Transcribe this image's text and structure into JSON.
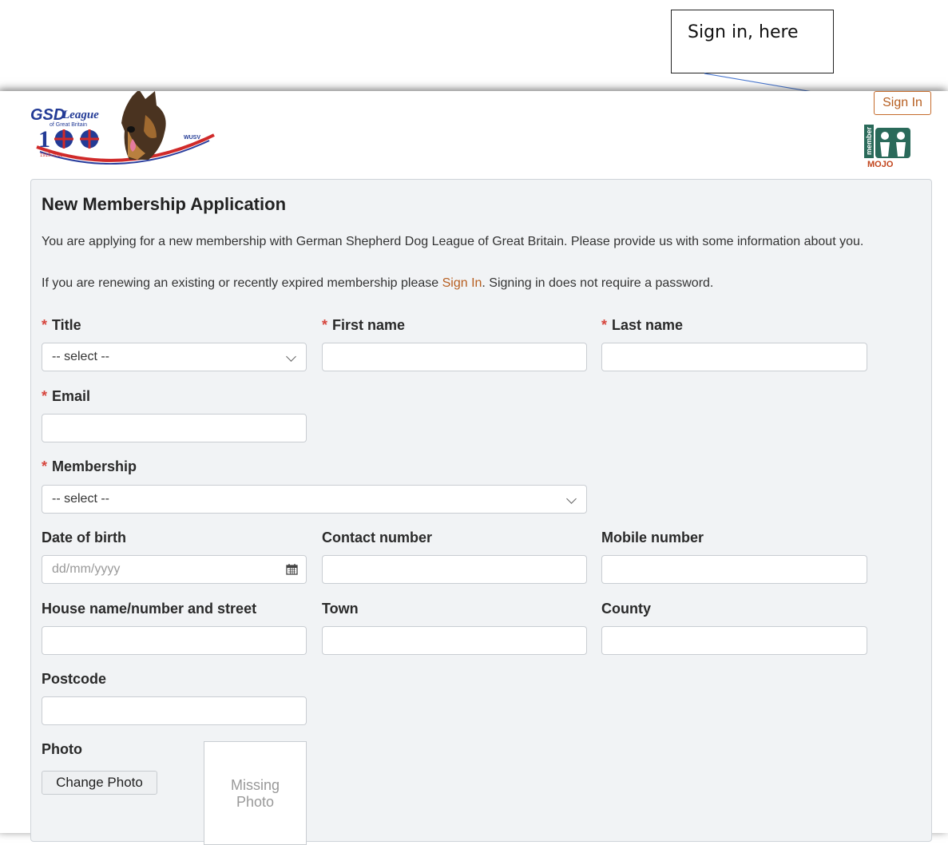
{
  "annotation": {
    "text": "Sign in, here"
  },
  "header": {
    "sign_in_button": "Sign In",
    "logo": {
      "brand": "GSD",
      "brand_script": "League",
      "sub": "of Great Britain",
      "years": "1919-2019",
      "badge": "WUSV"
    },
    "partner_logo": {
      "top": "member",
      "bottom": "MOJO"
    }
  },
  "form": {
    "heading": "New Membership Application",
    "intro": "You are applying for a new membership with German Shepherd Dog League of Great Britain. Please provide us with some information about you.",
    "renew_prefix": "If you are renewing an existing or recently expired membership please ",
    "renew_link": "Sign In",
    "renew_suffix": ". Signing in does not require a password.",
    "required_mark": "*",
    "fields": {
      "title": {
        "label": "Title",
        "value": "-- select --"
      },
      "first_name": {
        "label": "First name",
        "value": ""
      },
      "last_name": {
        "label": "Last name",
        "value": ""
      },
      "email": {
        "label": "Email",
        "value": ""
      },
      "membership": {
        "label": "Membership",
        "value": "-- select --"
      },
      "date_of_birth": {
        "label": "Date of birth",
        "placeholder": "dd/mm/yyyy"
      },
      "contact_number": {
        "label": "Contact number",
        "value": ""
      },
      "mobile_number": {
        "label": "Mobile number",
        "value": ""
      },
      "street": {
        "label": "House name/number and street",
        "value": ""
      },
      "town": {
        "label": "Town",
        "value": ""
      },
      "county": {
        "label": "County",
        "value": ""
      },
      "postcode": {
        "label": "Postcode",
        "value": ""
      },
      "photo": {
        "label": "Photo",
        "button": "Change Photo",
        "missing_line1": "Missing",
        "missing_line2": "Photo"
      }
    }
  },
  "colors": {
    "accent": "#b65e20",
    "required": "#d6453d",
    "panel_bg": "#f1f3f5",
    "arrow": "#4a78d0"
  }
}
